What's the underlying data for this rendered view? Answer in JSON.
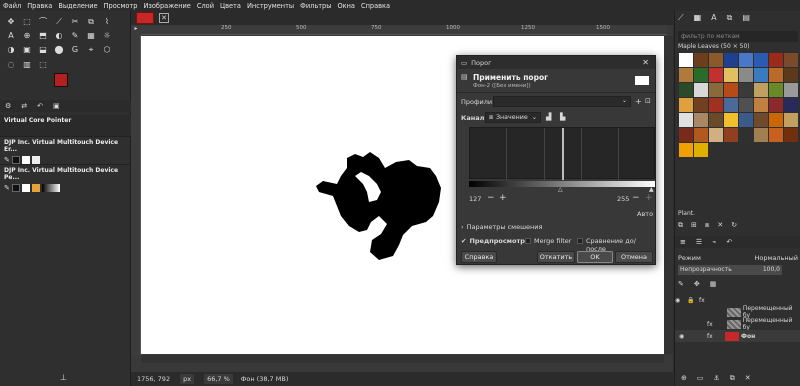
{
  "menu": [
    "Файл",
    "Правка",
    "Выделение",
    "Просмотр",
    "Изображение",
    "Слой",
    "Цвета",
    "Инструменты",
    "Фильтры",
    "Окна",
    "Справка"
  ],
  "ruler": {
    "ticks": [
      "250",
      "500",
      "750",
      "1000",
      "1250",
      "1500"
    ]
  },
  "devices": {
    "items": [
      {
        "label": "Virtual Core Pointer"
      },
      {
        "label": "DJP Inc. Virtual Multitouch Device Er..."
      },
      {
        "label": "DJP Inc. Virtual Multitouch Device Pe..."
      }
    ]
  },
  "status": {
    "coords": "1756, 792",
    "unit": "px",
    "zoom": "66,7 %",
    "info": "Фон (38,7 MB)"
  },
  "patterns": {
    "filter_placeholder": "фильтр по меткам",
    "title": "Maple Leaves (50 × 50)",
    "selected_name": "Plant."
  },
  "layers": {
    "mode_label": "Режим",
    "mode_value": "Нормальный",
    "opacity_label": "Непрозрачность",
    "opacity_value": "100,0",
    "items": [
      {
        "name": "Перемещенный бу"
      },
      {
        "name": "Перемещенный бу"
      },
      {
        "name": "Фон"
      }
    ]
  },
  "dialog": {
    "title": "Порог",
    "header": "Применить порог",
    "subheader": "Фон-2 ([Без имени])",
    "profiles_label": "Профили:",
    "channel_label": "Канал:",
    "channel_value": "Значение",
    "low_value": "127",
    "high_value": "255",
    "auto_label": "Авто",
    "blend_label": "Параметры смешения",
    "preview_label": "Предпросмотр",
    "merge_label": "Merge filter",
    "compare_label": "Сравнение до/после",
    "help": "Справка",
    "reset": "Откатить",
    "ok": "OK",
    "cancel": "Отмена"
  },
  "colors": {
    "fg": "#b42020",
    "bg": "#ffffff",
    "accent": "#d32f2f"
  }
}
